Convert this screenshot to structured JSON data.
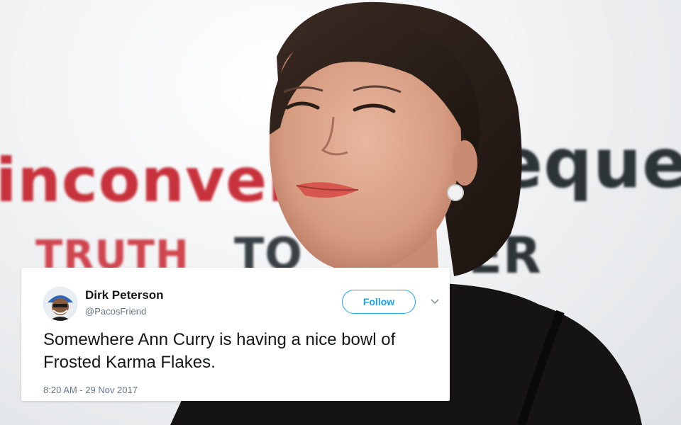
{
  "background": {
    "banner_words": [
      "inconver",
      "equel",
      "TRUTH",
      "TO",
      "ER"
    ]
  },
  "tweet": {
    "author_name": "Dirk Peterson",
    "handle": "@PacosFriend",
    "follow_label": "Follow",
    "text": "Somewhere Ann Curry is having a nice bowl of Frosted Karma Flakes.",
    "timestamp": "8:20 AM - 29 Nov 2017",
    "avatar_icon": "user-avatar-icon",
    "menu_icon": "chevron-down-icon",
    "accent_color": "#1da1f2"
  }
}
